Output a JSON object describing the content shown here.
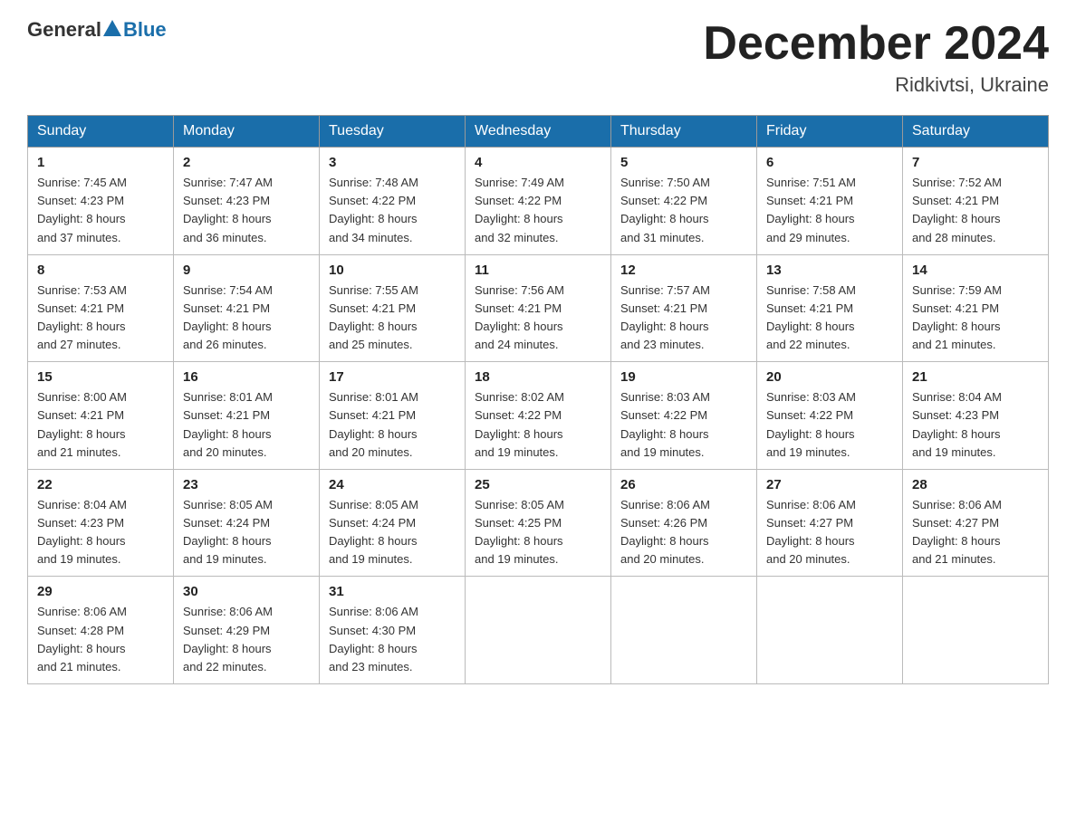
{
  "header": {
    "logo_general": "General",
    "logo_blue": "Blue",
    "month_title": "December 2024",
    "location": "Ridkivtsi, Ukraine"
  },
  "days_of_week": [
    "Sunday",
    "Monday",
    "Tuesday",
    "Wednesday",
    "Thursday",
    "Friday",
    "Saturday"
  ],
  "weeks": [
    [
      {
        "day": "1",
        "sunrise": "7:45 AM",
        "sunset": "4:23 PM",
        "daylight": "8 hours and 37 minutes."
      },
      {
        "day": "2",
        "sunrise": "7:47 AM",
        "sunset": "4:23 PM",
        "daylight": "8 hours and 36 minutes."
      },
      {
        "day": "3",
        "sunrise": "7:48 AM",
        "sunset": "4:22 PM",
        "daylight": "8 hours and 34 minutes."
      },
      {
        "day": "4",
        "sunrise": "7:49 AM",
        "sunset": "4:22 PM",
        "daylight": "8 hours and 32 minutes."
      },
      {
        "day": "5",
        "sunrise": "7:50 AM",
        "sunset": "4:22 PM",
        "daylight": "8 hours and 31 minutes."
      },
      {
        "day": "6",
        "sunrise": "7:51 AM",
        "sunset": "4:21 PM",
        "daylight": "8 hours and 29 minutes."
      },
      {
        "day": "7",
        "sunrise": "7:52 AM",
        "sunset": "4:21 PM",
        "daylight": "8 hours and 28 minutes."
      }
    ],
    [
      {
        "day": "8",
        "sunrise": "7:53 AM",
        "sunset": "4:21 PM",
        "daylight": "8 hours and 27 minutes."
      },
      {
        "day": "9",
        "sunrise": "7:54 AM",
        "sunset": "4:21 PM",
        "daylight": "8 hours and 26 minutes."
      },
      {
        "day": "10",
        "sunrise": "7:55 AM",
        "sunset": "4:21 PM",
        "daylight": "8 hours and 25 minutes."
      },
      {
        "day": "11",
        "sunrise": "7:56 AM",
        "sunset": "4:21 PM",
        "daylight": "8 hours and 24 minutes."
      },
      {
        "day": "12",
        "sunrise": "7:57 AM",
        "sunset": "4:21 PM",
        "daylight": "8 hours and 23 minutes."
      },
      {
        "day": "13",
        "sunrise": "7:58 AM",
        "sunset": "4:21 PM",
        "daylight": "8 hours and 22 minutes."
      },
      {
        "day": "14",
        "sunrise": "7:59 AM",
        "sunset": "4:21 PM",
        "daylight": "8 hours and 21 minutes."
      }
    ],
    [
      {
        "day": "15",
        "sunrise": "8:00 AM",
        "sunset": "4:21 PM",
        "daylight": "8 hours and 21 minutes."
      },
      {
        "day": "16",
        "sunrise": "8:01 AM",
        "sunset": "4:21 PM",
        "daylight": "8 hours and 20 minutes."
      },
      {
        "day": "17",
        "sunrise": "8:01 AM",
        "sunset": "4:21 PM",
        "daylight": "8 hours and 20 minutes."
      },
      {
        "day": "18",
        "sunrise": "8:02 AM",
        "sunset": "4:22 PM",
        "daylight": "8 hours and 19 minutes."
      },
      {
        "day": "19",
        "sunrise": "8:03 AM",
        "sunset": "4:22 PM",
        "daylight": "8 hours and 19 minutes."
      },
      {
        "day": "20",
        "sunrise": "8:03 AM",
        "sunset": "4:22 PM",
        "daylight": "8 hours and 19 minutes."
      },
      {
        "day": "21",
        "sunrise": "8:04 AM",
        "sunset": "4:23 PM",
        "daylight": "8 hours and 19 minutes."
      }
    ],
    [
      {
        "day": "22",
        "sunrise": "8:04 AM",
        "sunset": "4:23 PM",
        "daylight": "8 hours and 19 minutes."
      },
      {
        "day": "23",
        "sunrise": "8:05 AM",
        "sunset": "4:24 PM",
        "daylight": "8 hours and 19 minutes."
      },
      {
        "day": "24",
        "sunrise": "8:05 AM",
        "sunset": "4:24 PM",
        "daylight": "8 hours and 19 minutes."
      },
      {
        "day": "25",
        "sunrise": "8:05 AM",
        "sunset": "4:25 PM",
        "daylight": "8 hours and 19 minutes."
      },
      {
        "day": "26",
        "sunrise": "8:06 AM",
        "sunset": "4:26 PM",
        "daylight": "8 hours and 20 minutes."
      },
      {
        "day": "27",
        "sunrise": "8:06 AM",
        "sunset": "4:27 PM",
        "daylight": "8 hours and 20 minutes."
      },
      {
        "day": "28",
        "sunrise": "8:06 AM",
        "sunset": "4:27 PM",
        "daylight": "8 hours and 21 minutes."
      }
    ],
    [
      {
        "day": "29",
        "sunrise": "8:06 AM",
        "sunset": "4:28 PM",
        "daylight": "8 hours and 21 minutes."
      },
      {
        "day": "30",
        "sunrise": "8:06 AM",
        "sunset": "4:29 PM",
        "daylight": "8 hours and 22 minutes."
      },
      {
        "day": "31",
        "sunrise": "8:06 AM",
        "sunset": "4:30 PM",
        "daylight": "8 hours and 23 minutes."
      },
      null,
      null,
      null,
      null
    ]
  ],
  "labels": {
    "sunrise_label": "Sunrise:",
    "sunset_label": "Sunset:",
    "daylight_label": "Daylight:"
  }
}
